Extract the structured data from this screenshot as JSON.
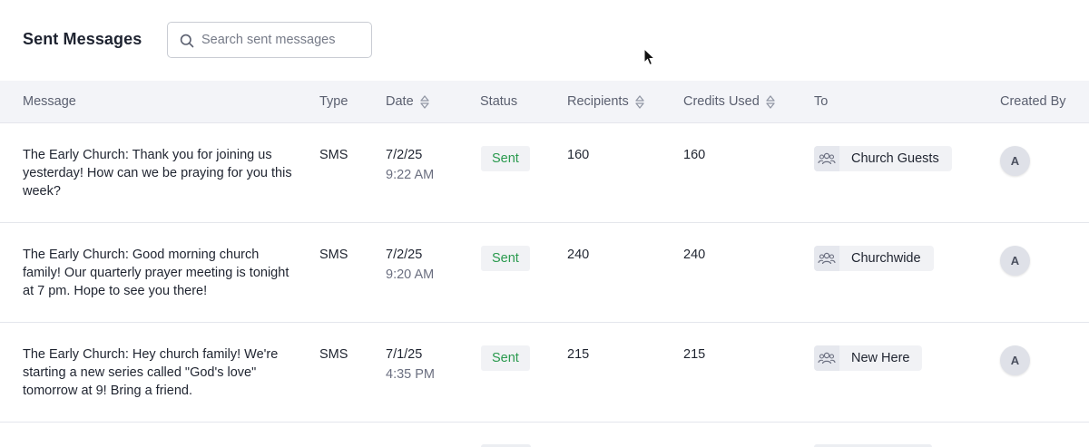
{
  "header": {
    "title": "Sent Messages",
    "search_placeholder": "Search sent messages"
  },
  "table": {
    "columns": [
      "Message",
      "Type",
      "Date",
      "Status",
      "Recipients",
      "Credits Used",
      "To",
      "Created By"
    ],
    "sortable_columns": [
      "Date",
      "Recipients",
      "Credits Used"
    ],
    "rows": [
      {
        "message": "The Early Church: Thank you for joining us yesterday! How can we be praying for you this week?",
        "type": "SMS",
        "date": "7/2/25",
        "time": "9:22 AM",
        "status": "Sent",
        "recipients": "160",
        "credits": "160",
        "to": "Church Guests",
        "created_by": "A"
      },
      {
        "message": "The Early Church: Good morning church family! Our quarterly prayer meeting is tonight at 7 pm. Hope to see you there!",
        "type": "SMS",
        "date": "7/2/25",
        "time": "9:20 AM",
        "status": "Sent",
        "recipients": "240",
        "credits": "240",
        "to": "Churchwide",
        "created_by": "A"
      },
      {
        "message": "The Early Church: Hey church family! We're starting a new series called \"God's love\" tomorrow at 9! Bring a friend.",
        "type": "SMS",
        "date": "7/1/25",
        "time": "4:35 PM",
        "status": "Sent",
        "recipients": "215",
        "credits": "215",
        "to": "New Here",
        "created_by": "A"
      }
    ]
  },
  "colors": {
    "status_sent": "#2a9a4e",
    "header_bg": "#f3f4f8",
    "chip_bg": "#f1f2f5"
  },
  "icons": {
    "search": "search-icon",
    "sort": "sort-icon",
    "group": "group-icon",
    "cursor": "mouse-cursor"
  }
}
